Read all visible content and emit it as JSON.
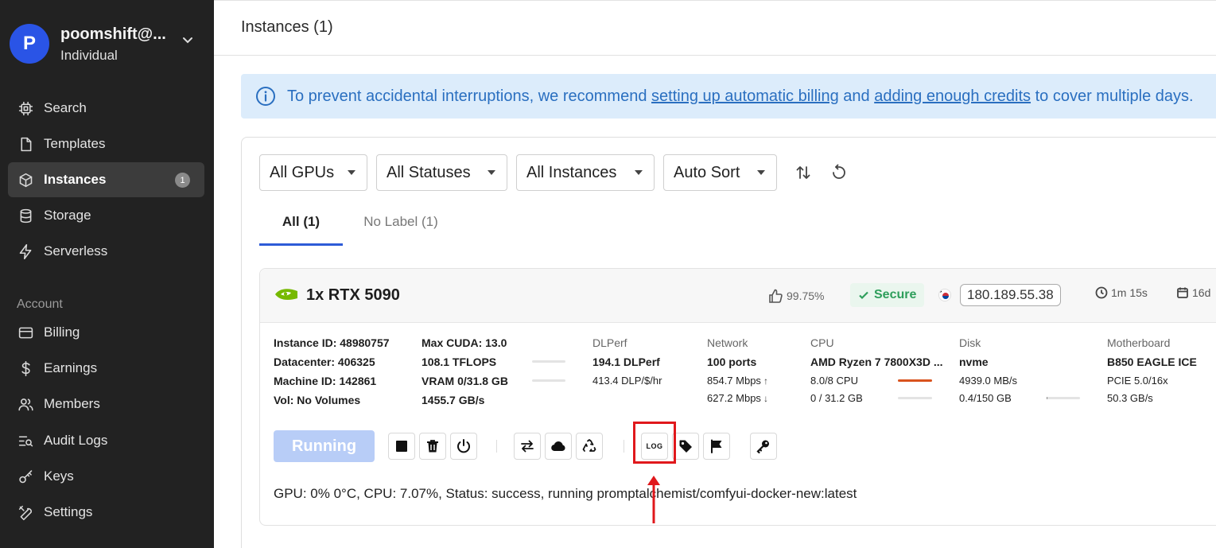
{
  "sidebar": {
    "user": {
      "initial": "P",
      "name": "poomshift@...",
      "role": "Individual"
    },
    "items": [
      {
        "label": "Search",
        "icon": "cpu-chip-icon"
      },
      {
        "label": "Templates",
        "icon": "document-icon"
      },
      {
        "label": "Instances",
        "icon": "cube-icon",
        "badge": "1",
        "active": true
      },
      {
        "label": "Storage",
        "icon": "database-icon"
      },
      {
        "label": "Serverless",
        "icon": "lightning-icon"
      }
    ],
    "account_label": "Account",
    "account_items": [
      {
        "label": "Billing",
        "icon": "credit-card-icon"
      },
      {
        "label": "Earnings",
        "icon": "dollar-icon"
      },
      {
        "label": "Members",
        "icon": "users-icon"
      },
      {
        "label": "Audit Logs",
        "icon": "audit-list-icon"
      },
      {
        "label": "Keys",
        "icon": "key-icon"
      },
      {
        "label": "Settings",
        "icon": "tools-icon"
      }
    ]
  },
  "header": {
    "title": "Instances (1)"
  },
  "alert": {
    "prefix": "To prevent accidental interruptions, we recommend ",
    "link1": "setting up automatic billing",
    "middle": " and ",
    "link2": "adding enough credits",
    "suffix": " to cover multiple days."
  },
  "filters": {
    "gpus": "All GPUs",
    "statuses": "All Statuses",
    "instances": "All Instances",
    "sort": "Auto Sort"
  },
  "tabs": [
    {
      "label": "All (1)",
      "active": true
    },
    {
      "label": "No Label (1)",
      "active": false
    }
  ],
  "instance": {
    "gpu_name": "1x RTX 5090",
    "reliability": "99.75%",
    "secure_label": "Secure",
    "ip": "180.189.55.38",
    "uptime": "1m 15s",
    "duration": "16d",
    "col1": {
      "instance_id": "Instance ID: 48980757",
      "datacenter": "Datacenter: 406325",
      "machine_id": "Machine ID: 142861",
      "volume": "Vol: No Volumes"
    },
    "col2": {
      "max_cuda": "Max CUDA: 13.0",
      "tflops": "108.1 TFLOPS",
      "vram": "VRAM 0/31.8 GB",
      "bandwidth": "1455.7 GB/s",
      "vram_fraction": 0.0
    },
    "dlperf": {
      "head": "DLPerf",
      "value": "194.1 DLPerf",
      "per_dollar": "413.4 DLP/$/hr"
    },
    "network": {
      "head": "Network",
      "ports": "100 ports",
      "up": "854.7 Mbps",
      "down": "627.2 Mbps"
    },
    "cpu": {
      "head": "CPU",
      "model": "AMD Ryzen 7 7800X3D ...",
      "cores": "8.0/8 CPU",
      "ram": "0 / 31.2 GB",
      "core_fraction": 1.0,
      "ram_fraction": 0.0
    },
    "disk": {
      "head": "Disk",
      "type": "nvme",
      "speed": "4939.0 MB/s",
      "usage": "0.4/150 GB",
      "usage_fraction": 0.003
    },
    "motherboard": {
      "head": "Motherboard",
      "name": "B850 EAGLE ICE",
      "pcie": "PCIE 5.0/16x",
      "speed": "50.3 GB/s"
    },
    "status_button": "Running",
    "log_label": "LOG",
    "status_line": "GPU: 0% 0°C, CPU: 7.07%, Status: success, running promptalchemist/comfyui-docker-new:latest"
  },
  "colors": {
    "sidebar_bg": "#222222",
    "accent_blue": "#2d5bd7",
    "alert_bg": "#dcecfb",
    "secure_green": "#2e9e5b",
    "highlight_red": "#e0181c"
  }
}
